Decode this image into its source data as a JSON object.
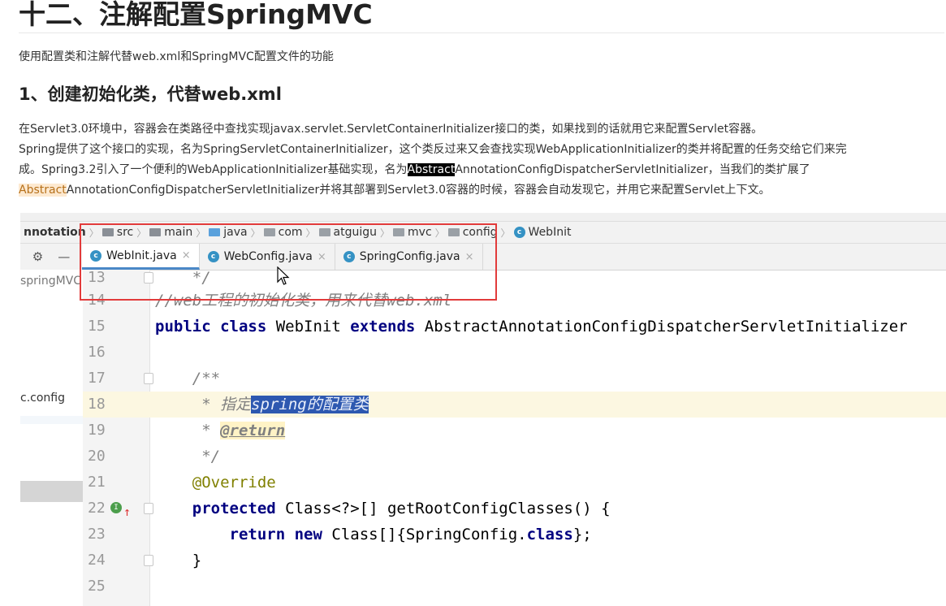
{
  "article": {
    "title": "十二、注解配置SpringMVC",
    "intro": "使用配置类和注解代替web.xml和SpringMVC配置文件的功能",
    "section_title": "1、创建初始化类，代替web.xml",
    "para_line1": "在Servlet3.0环境中，容器会在类路径中查找实现javax.servlet.ServletContainerInitializer接口的类，如果找到的话就用它来配置Servlet容器。",
    "para_line2": "Spring提供了这个接口的实现，名为SpringServletContainerInitializer，这个类反过来又会查找实现WebApplicationInitializer的类并将配置的任务交给它们来完",
    "para_line3_a": "成。Spring3.2引入了一个便利的WebApplicationInitializer基础实现，名为",
    "para_line3_hl": "Abstract",
    "para_line3_b": "AnnotationConfigDispatcherServletInitializer，当我们的类扩展了",
    "para_line4_hl": "Abstract",
    "para_line4_b": "AnnotationConfigDispatcherServletInitializer并将其部署到Servlet3.0容器的时候，容器会自动发现它，并用它来配置Servlet上下文。"
  },
  "ide": {
    "breadcrumb": [
      "nnotation",
      "src",
      "main",
      "java",
      "com",
      "atguigu",
      "mvc",
      "config",
      "WebInit"
    ],
    "tabs": [
      "WebInit.java",
      "WebConfig.java",
      "SpringConfig.java"
    ],
    "close_glyph": "×",
    "project_label": "springMVC",
    "project_config": "c.config",
    "line_numbers": [
      "13",
      "14",
      "15",
      "16",
      "17",
      "18",
      "19",
      "20",
      "21",
      "22",
      "23",
      "24",
      "25"
    ],
    "code": {
      "l13": "    */",
      "l14": "//web工程的初始化类，用来代替web.xml",
      "l15_kw1": "public",
      "l15_kw2": "class",
      "l15_name": " WebInit ",
      "l15_kw3": "extends",
      "l15_rest": " AbstractAnnotationConfigDispatcherServletInitializer",
      "l17": "    /**",
      "l18_a": "     * 指定",
      "l18_sel": "spring的配置类",
      "l19_a": "     * ",
      "l19_tag": "@return",
      "l20": "     */",
      "l21": "    @Override",
      "l22_kw": "protected",
      "l22_rest": " Class<?>[] getRootConfigClasses() {",
      "l23_kw1": "return",
      "l23_kw2": "new",
      "l23_mid": " Class[]{SpringConfig.",
      "l23_kw3": "class",
      "l23_end": "};",
      "l24": "    }"
    }
  }
}
